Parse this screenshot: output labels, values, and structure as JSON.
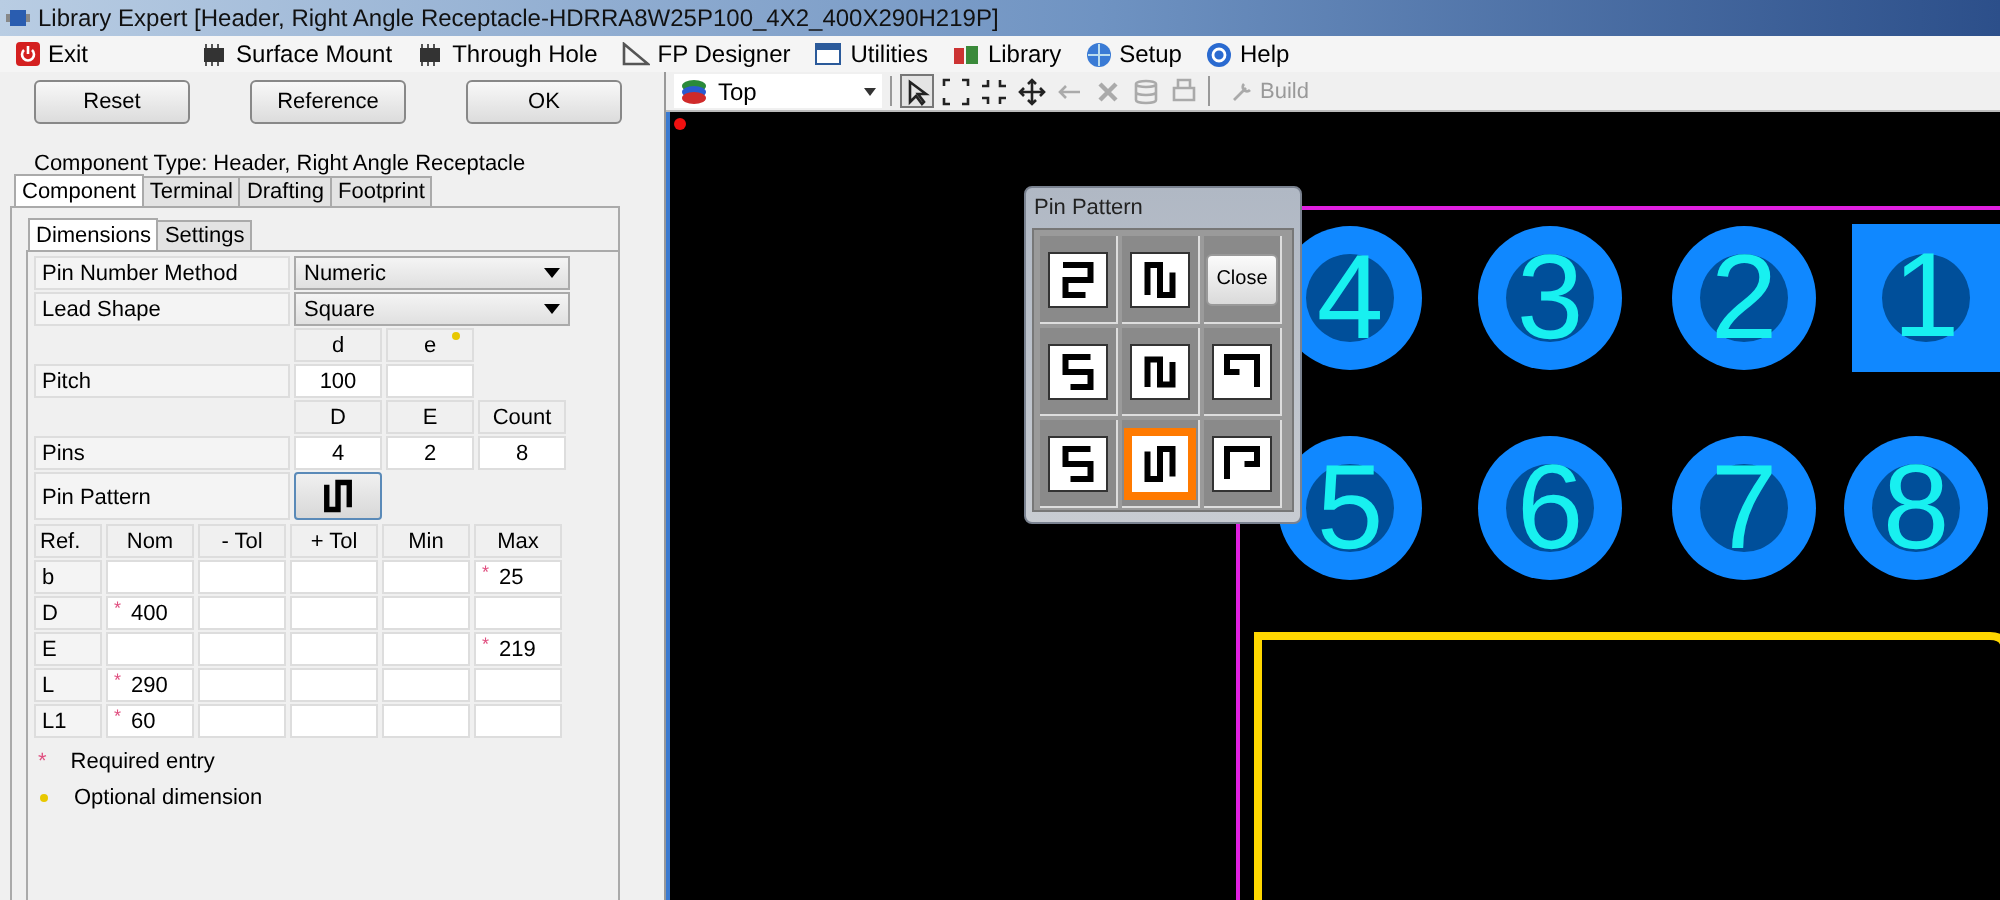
{
  "window": {
    "title": "Library Expert [Header, Right Angle Receptacle-HDRRA8W25P100_4X2_400X290H219P]"
  },
  "menu": [
    {
      "label": "Exit",
      "kind": "exit"
    },
    {
      "label": "Surface Mount",
      "kind": "smd"
    },
    {
      "label": "Through Hole",
      "kind": "th"
    },
    {
      "label": "FP Designer",
      "kind": "designer"
    },
    {
      "label": "Utilities",
      "kind": "utilities"
    },
    {
      "label": "Library",
      "kind": "library"
    },
    {
      "label": "Setup",
      "kind": "setup"
    },
    {
      "label": "Help",
      "kind": "help"
    }
  ],
  "actions": [
    "Reset",
    "Reference",
    "OK"
  ],
  "component_type": "Component Type: Header, Right Angle Receptacle",
  "tabs": [
    {
      "label": "Component",
      "selected": true
    },
    {
      "label": "Terminal",
      "selected": false
    },
    {
      "label": "Drafting",
      "selected": false
    },
    {
      "label": "Footprint",
      "selected": false
    }
  ],
  "subtabs": [
    {
      "label": "Dimensions",
      "selected": true
    },
    {
      "label": "Settings",
      "selected": false
    }
  ],
  "form": {
    "pin_number_method": {
      "label": "Pin Number Method",
      "value": "Numeric"
    },
    "lead_shape": {
      "label": "Lead Shape",
      "value": "Square"
    },
    "pitch": {
      "label": "Pitch",
      "headers": [
        {
          "text": "d",
          "optional": false
        },
        {
          "text": "e",
          "optional": true
        }
      ],
      "values": [
        "100"
      ]
    },
    "pins": {
      "label": "Pins",
      "headers": [
        {
          "text": "D",
          "optional": false
        },
        {
          "text": "E",
          "optional": false
        },
        {
          "text": "Count",
          "optional": false
        }
      ],
      "values": [
        "4",
        "2",
        "8"
      ]
    },
    "pin_pattern": {
      "label": "Pin Pattern"
    }
  },
  "dimensions": {
    "columns": [
      "Ref.",
      "Nom",
      "- Tol",
      "+ Tol",
      "Min",
      "Max"
    ],
    "rows": [
      {
        "ref": "b",
        "cells": [
          null,
          null,
          null,
          null,
          {
            "value": "25",
            "mark": "*"
          }
        ]
      },
      {
        "ref": "D",
        "cells": [
          {
            "value": "400",
            "mark": "*"
          },
          null,
          null,
          null,
          null
        ]
      },
      {
        "ref": "E",
        "cells": [
          null,
          null,
          null,
          null,
          {
            "value": "219",
            "mark": "*"
          }
        ]
      },
      {
        "ref": "L",
        "cells": [
          {
            "value": "290",
            "mark": "*"
          },
          null,
          null,
          null,
          null
        ]
      },
      {
        "ref": "L1",
        "cells": [
          {
            "value": "60",
            "mark": "*"
          },
          null,
          null,
          null,
          null
        ]
      }
    ]
  },
  "legend": [
    {
      "kind": "required",
      "mark": "*",
      "text": "Required entry"
    },
    {
      "kind": "optional",
      "text": "Optional dimension"
    }
  ],
  "toolbar": {
    "layer": "Top",
    "tools": [
      {
        "kind": "select",
        "selected": true,
        "disabled": false
      },
      {
        "kind": "zoom-extents",
        "selected": false,
        "disabled": false
      },
      {
        "kind": "zoom-fit",
        "selected": false,
        "disabled": false
      },
      {
        "kind": "pan",
        "selected": false,
        "disabled": false
      },
      {
        "kind": "undo",
        "selected": false,
        "disabled": true
      },
      {
        "kind": "delete",
        "selected": false,
        "disabled": true
      },
      {
        "kind": "database",
        "selected": false,
        "disabled": true
      },
      {
        "kind": "print",
        "selected": false,
        "disabled": true
      }
    ],
    "build": {
      "label": "Build",
      "disabled": true
    }
  },
  "pads": [
    {
      "label": "4",
      "kind": "round"
    },
    {
      "label": "3",
      "kind": "round"
    },
    {
      "label": "2",
      "kind": "round"
    },
    {
      "label": "1",
      "kind": "square"
    },
    {
      "label": "5",
      "kind": "round"
    },
    {
      "label": "6",
      "kind": "round"
    },
    {
      "label": "7",
      "kind": "round"
    },
    {
      "label": "8",
      "kind": "round"
    }
  ],
  "pin_pattern_dialog": {
    "title": "Pin Pattern",
    "close_label": "Close",
    "patterns": [
      {
        "selected": false
      },
      {
        "selected": false
      },
      {
        "selected": false
      },
      {
        "selected": false
      },
      {
        "selected": false
      },
      {
        "selected": false
      },
      {
        "selected": true
      },
      {
        "selected": false
      }
    ]
  }
}
